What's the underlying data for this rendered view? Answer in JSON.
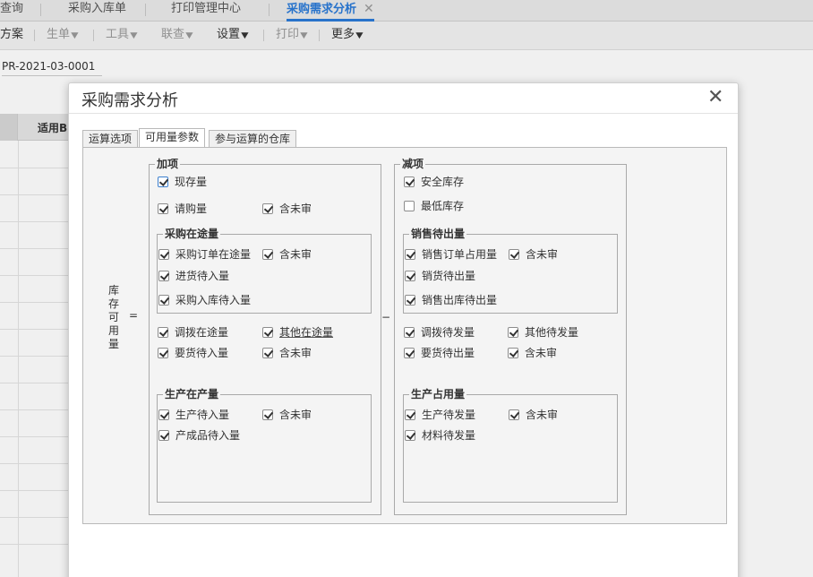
{
  "top_tabs": [
    {
      "label": "查询"
    },
    {
      "label": "采购入库单"
    },
    {
      "label": "打印管理中心"
    },
    {
      "label": "采购需求分析",
      "close": "✕"
    }
  ],
  "menu": {
    "items": [
      "方案",
      "生单",
      "工具",
      "联查",
      "设置",
      "打印",
      "更多"
    ]
  },
  "form": {
    "doc_no": "PR-2021-03-0001",
    "grid_header": "适用B"
  },
  "dialog": {
    "title": "采购需求分析",
    "close": "✕",
    "tabs": [
      "运算选项",
      "可用量参数",
      "参与运算的仓库"
    ],
    "active_tab": 1,
    "formula": {
      "label_chars": [
        "库",
        "存",
        "可",
        "用",
        "量"
      ],
      "equals": "=",
      "minus": "−"
    },
    "add": {
      "title": "加项",
      "xianchunliang": {
        "label": "现存量",
        "checked": true
      },
      "qinggouliang": {
        "label": "请购量",
        "checked": true
      },
      "qinggou_hanweishen": {
        "label": "含未审",
        "checked": true
      },
      "cg_zaitu": {
        "title": "采购在途量",
        "order": {
          "label": "采购订单在途量",
          "checked": true
        },
        "order_hanweishen": {
          "label": "含未审",
          "checked": true
        },
        "jinhuo": {
          "label": "进货待入量",
          "checked": true
        },
        "rukudan": {
          "label": "采购入库待入量",
          "checked": true
        }
      },
      "diaobo": {
        "label": "调拨在途量",
        "checked": true
      },
      "qita": {
        "label": "其他在途量",
        "checked": true
      },
      "yaohuo": {
        "label": "要货待入量",
        "checked": true
      },
      "yaohuo_hanweishen": {
        "label": "含未审",
        "checked": true
      },
      "sc_zaichan": {
        "title": "生产在产量",
        "shengchan": {
          "label": "生产待入量",
          "checked": true
        },
        "shengchan_hanweishen": {
          "label": "含未审",
          "checked": true
        },
        "chanchengpin": {
          "label": "产成品待入量",
          "checked": true
        }
      }
    },
    "subtract": {
      "title": "减项",
      "anquan": {
        "label": "安全库存",
        "checked": true
      },
      "zuidi": {
        "label": "最低库存",
        "checked": false
      },
      "xs_daichu": {
        "title": "销售待出量",
        "order": {
          "label": "销售订单占用量",
          "checked": true
        },
        "order_hanweishen": {
          "label": "含未审",
          "checked": true
        },
        "xiaoshou": {
          "label": "销货待出量",
          "checked": true
        },
        "chuku": {
          "label": "销售出库待出量",
          "checked": true
        }
      },
      "diaobo": {
        "label": "调拨待发量",
        "checked": true
      },
      "qita": {
        "label": "其他待发量",
        "checked": true
      },
      "yaohuo": {
        "label": "要货待出量",
        "checked": true
      },
      "yaohuo_hanweishen": {
        "label": "含未审",
        "checked": true
      },
      "sc_zhanyong": {
        "title": "生产占用量",
        "shengchan": {
          "label": "生产待发量",
          "checked": true
        },
        "shengchan_hanweishen": {
          "label": "含未审",
          "checked": true
        },
        "cailiao": {
          "label": "材料待发量",
          "checked": true
        }
      }
    }
  }
}
